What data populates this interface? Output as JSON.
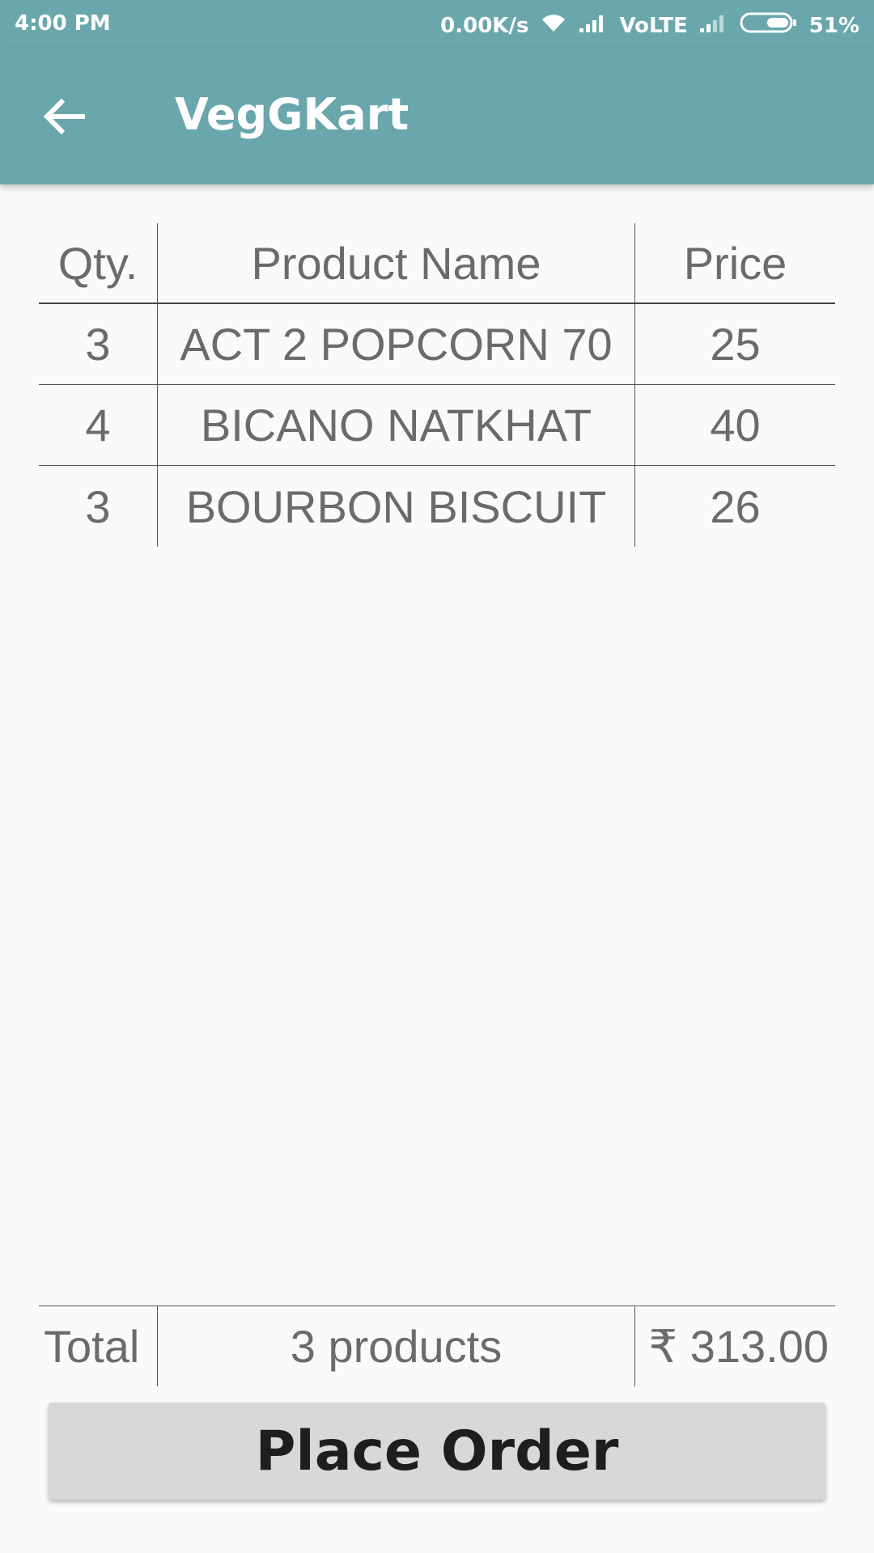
{
  "status_bar": {
    "time": "4:00 PM",
    "speed": "0.00K/s",
    "network": "VoLTE",
    "battery": "51%",
    "icons": [
      "wifi-icon",
      "signal-icon",
      "signal-icon",
      "battery-icon"
    ]
  },
  "app_bar": {
    "title": "VegGKart",
    "back_icon": "arrow-left-icon",
    "background_color": "#6aa7ac"
  },
  "table": {
    "headers": {
      "qty": "Qty.",
      "name": "Product Name",
      "price": "Price"
    },
    "rows": [
      {
        "qty": "3",
        "name": "ACT 2 POPCORN 70",
        "price": "25"
      },
      {
        "qty": "4",
        "name": "BICANO NATKHAT",
        "price": "40"
      },
      {
        "qty": "3",
        "name": "BOURBON BISCUIT",
        "price": "26"
      }
    ]
  },
  "totals": {
    "label": "Total",
    "count": "3 products",
    "amount": "₹ 313.00"
  },
  "actions": {
    "place_order_label": "Place Order"
  }
}
